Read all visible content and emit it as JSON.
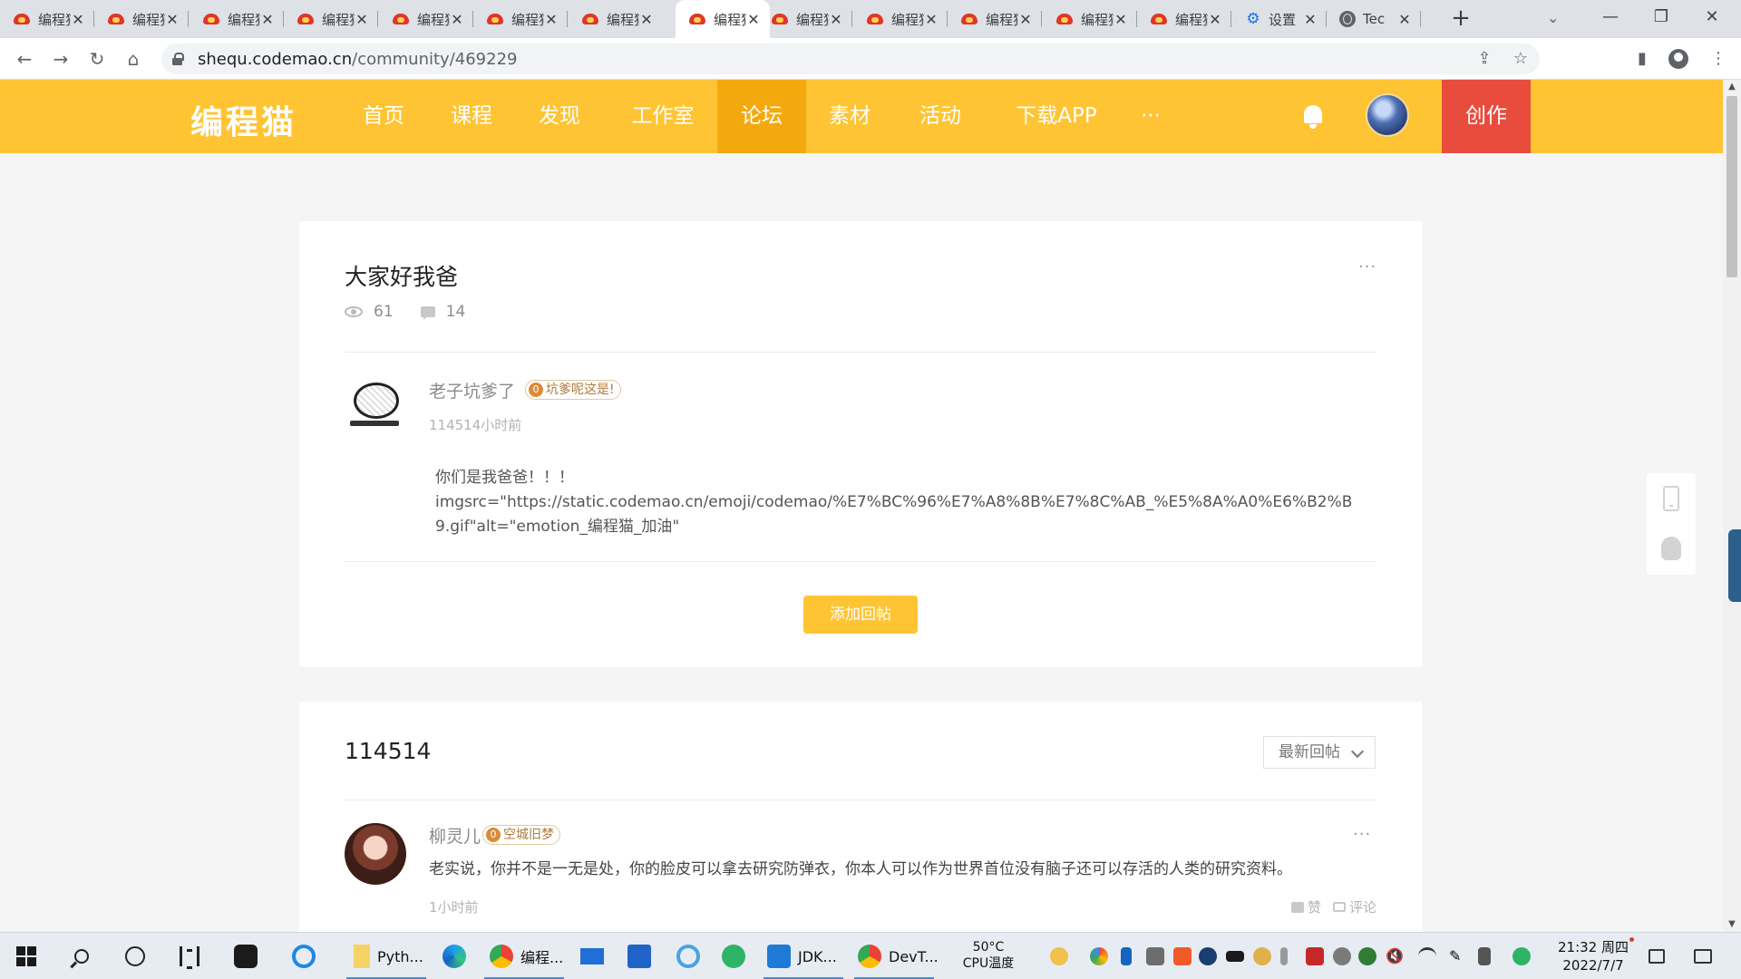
{
  "browser": {
    "tabs": [
      {
        "title": "编程猫",
        "icon": "codemao-icon"
      },
      {
        "title": "编程猫",
        "icon": "codemao-icon"
      },
      {
        "title": "编程猫",
        "icon": "codemao-icon"
      },
      {
        "title": "编程猫",
        "icon": "codemao-icon"
      },
      {
        "title": "编程猫",
        "icon": "codemao-icon"
      },
      {
        "title": "编程猫",
        "icon": "codemao-icon"
      },
      {
        "title": "编程猫",
        "icon": "codemao-icon"
      },
      {
        "title": "编程猫",
        "icon": "codemao-icon",
        "active": true
      },
      {
        "title": "编程猫",
        "icon": "codemao-icon"
      },
      {
        "title": "编程猫",
        "icon": "codemao-icon"
      },
      {
        "title": "编程猫",
        "icon": "codemao-icon"
      },
      {
        "title": "编程猫",
        "icon": "codemao-icon"
      },
      {
        "title": "编程猫",
        "icon": "codemao-icon"
      },
      {
        "title": "设置",
        "icon": "gear-icon"
      },
      {
        "title": "Tec",
        "icon": "globe-icon"
      }
    ],
    "close_glyph": "✕",
    "new_tab_glyph": "+",
    "url_host": "shequ.codemao.cn",
    "url_path": "/community/469229"
  },
  "site": {
    "logo": "编程猫",
    "nav": [
      "首页",
      "课程",
      "发现",
      "工作室",
      "论坛",
      "素材",
      "活动",
      "下载APP",
      "···"
    ],
    "active_nav": "论坛",
    "create_label": "创作",
    "brand_color": "#fec433",
    "create_color": "#e84c3d"
  },
  "post": {
    "title": "大家好我爸",
    "views": "61",
    "comments": "14",
    "more": "···",
    "author": "老子坑爹了",
    "author_badge": "坑爹呢这是!",
    "badge_level": "0",
    "time": "114514小时前",
    "body_lines": [
      "你们是我爸爸！！！",
      "imgsrc=\"https://static.codemao.cn/emoji/codemao/%E7%BC%96%E7%A8%8B%E7%8C%AB_%E5%8A%A0%E6%B2%B",
      "9.gif\"alt=\"emotion_编程猫_加油\""
    ],
    "reply_button": "添加回帖"
  },
  "replies": {
    "count_title": "114514",
    "sort_selected": "最新回帖",
    "items": [
      {
        "author": "柳灵儿",
        "badge": "空城旧梦",
        "badge_level": "0",
        "body": "老实说，你并不是一无是处，你的脸皮可以拿去研究防弹衣，你本人可以作为世界首位没有脑子还可以存活的人类的研究资料。",
        "time": "1小时前",
        "like_label": "赞",
        "comment_label": "评论",
        "more": "···"
      }
    ]
  },
  "taskbar": {
    "apps": [
      "Pyth...",
      "编程...",
      "JDK...",
      "DevT..."
    ],
    "cpu_temp": "50°C",
    "cpu_label": "CPU温度",
    "time": "21:32 周四",
    "date": "2022/7/7"
  }
}
